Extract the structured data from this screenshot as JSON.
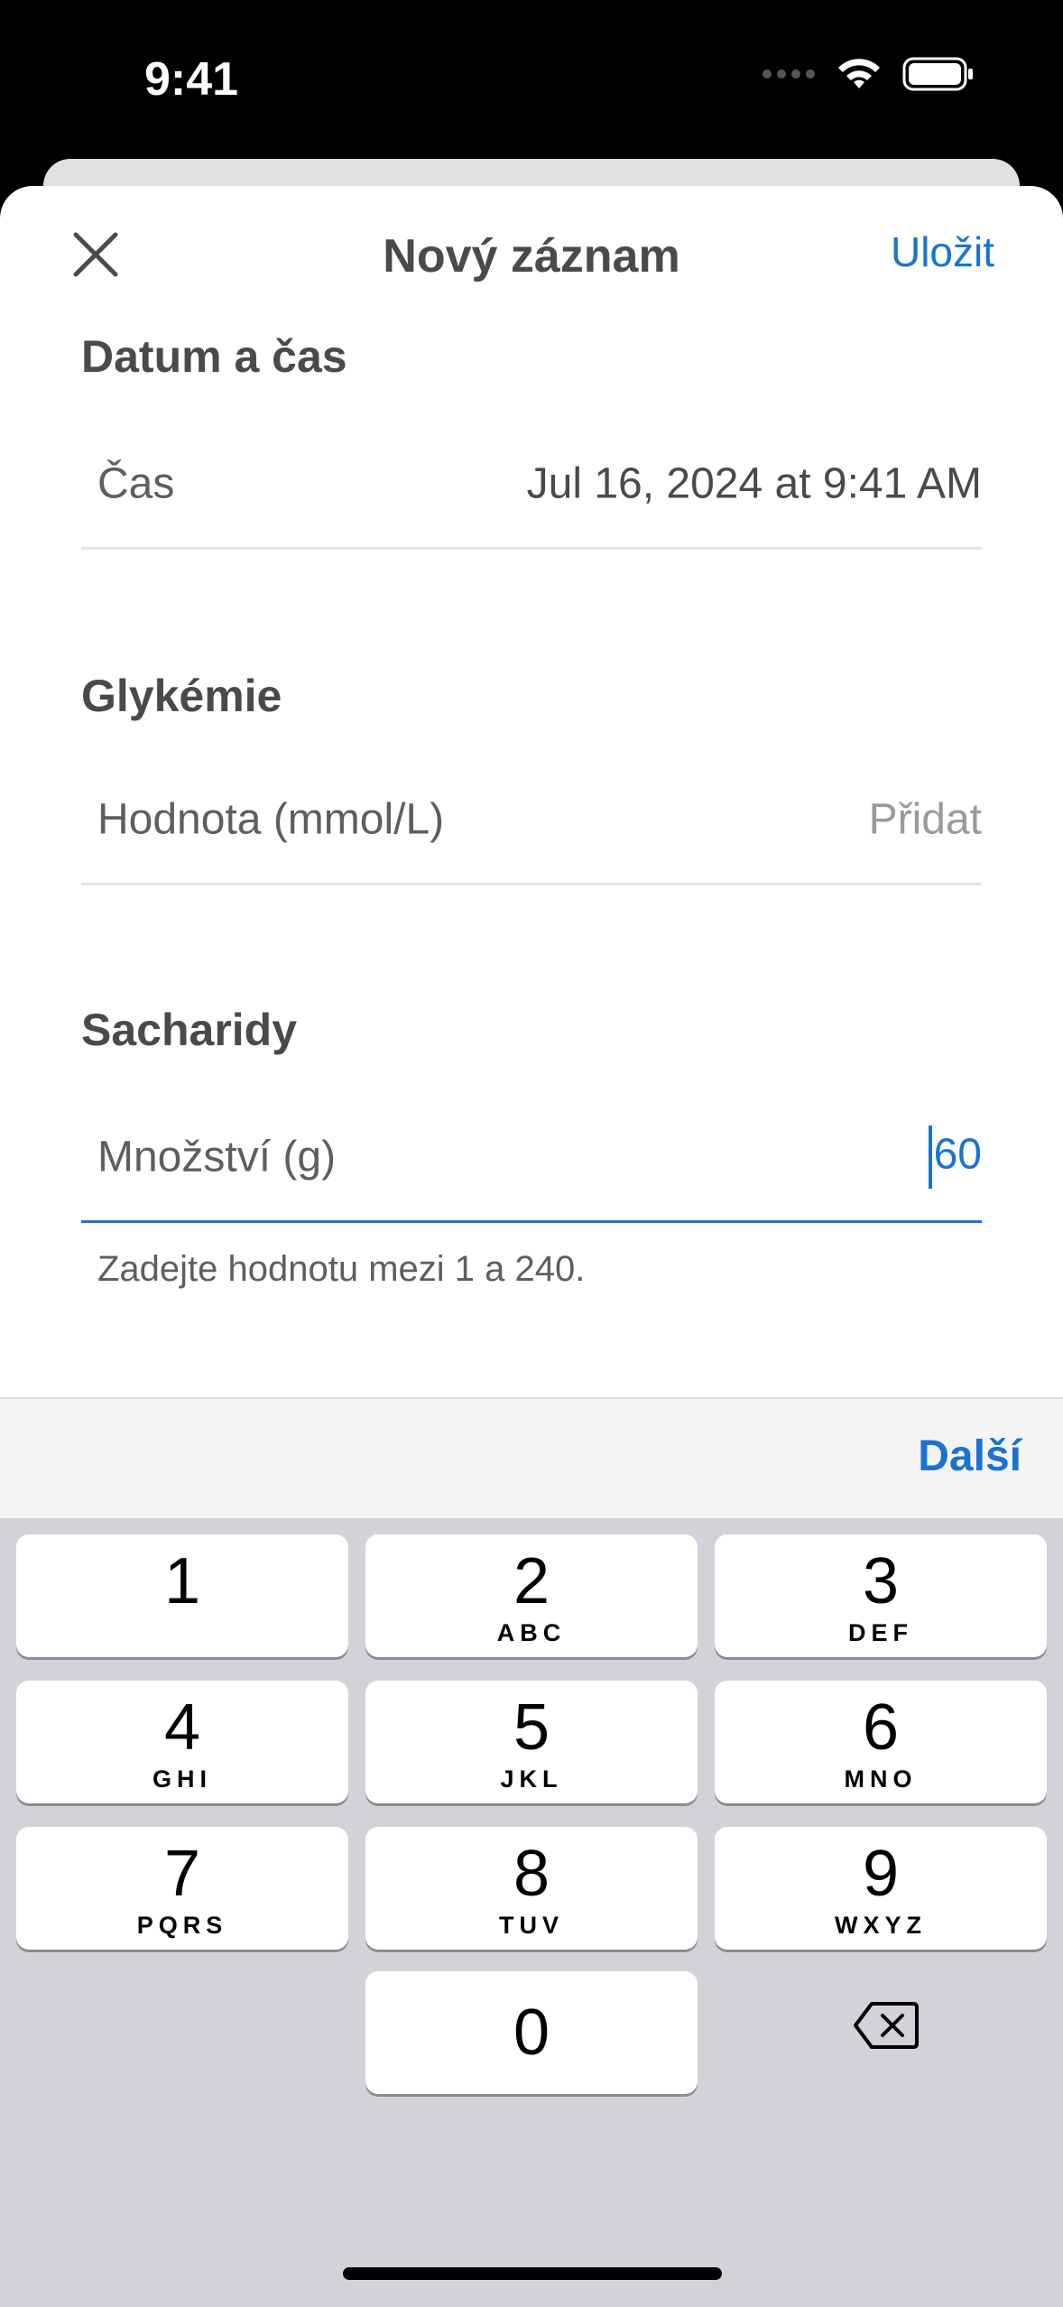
{
  "status_bar": {
    "time": "9:41"
  },
  "nav": {
    "title": "Nový záznam",
    "save_label": "Uložit"
  },
  "sections": {
    "datetime": {
      "title": "Datum a čas",
      "label": "Čas",
      "value": "Jul 16, 2024 at 9:41 AM"
    },
    "glucose": {
      "title": "Glykémie",
      "label": "Hodnota (mmol/L)",
      "placeholder": "Přidat"
    },
    "carbs": {
      "title": "Sacharidy",
      "label": "Množství (g)",
      "value": "60",
      "hint": "Zadejte hodnotu mezi 1 a 240."
    }
  },
  "accessory": {
    "next_label": "Další"
  },
  "keyboard": {
    "keys": [
      {
        "digit": "1",
        "letters": ""
      },
      {
        "digit": "2",
        "letters": "ABC"
      },
      {
        "digit": "3",
        "letters": "DEF"
      },
      {
        "digit": "4",
        "letters": "GHI"
      },
      {
        "digit": "5",
        "letters": "JKL"
      },
      {
        "digit": "6",
        "letters": "MNO"
      },
      {
        "digit": "7",
        "letters": "PQRS"
      },
      {
        "digit": "8",
        "letters": "TUV"
      },
      {
        "digit": "9",
        "letters": "WXYZ"
      },
      {
        "digit": "0",
        "letters": ""
      }
    ]
  },
  "colors": {
    "accent": "#1a73d1",
    "keyboard_bg": "#d1d3d9"
  }
}
